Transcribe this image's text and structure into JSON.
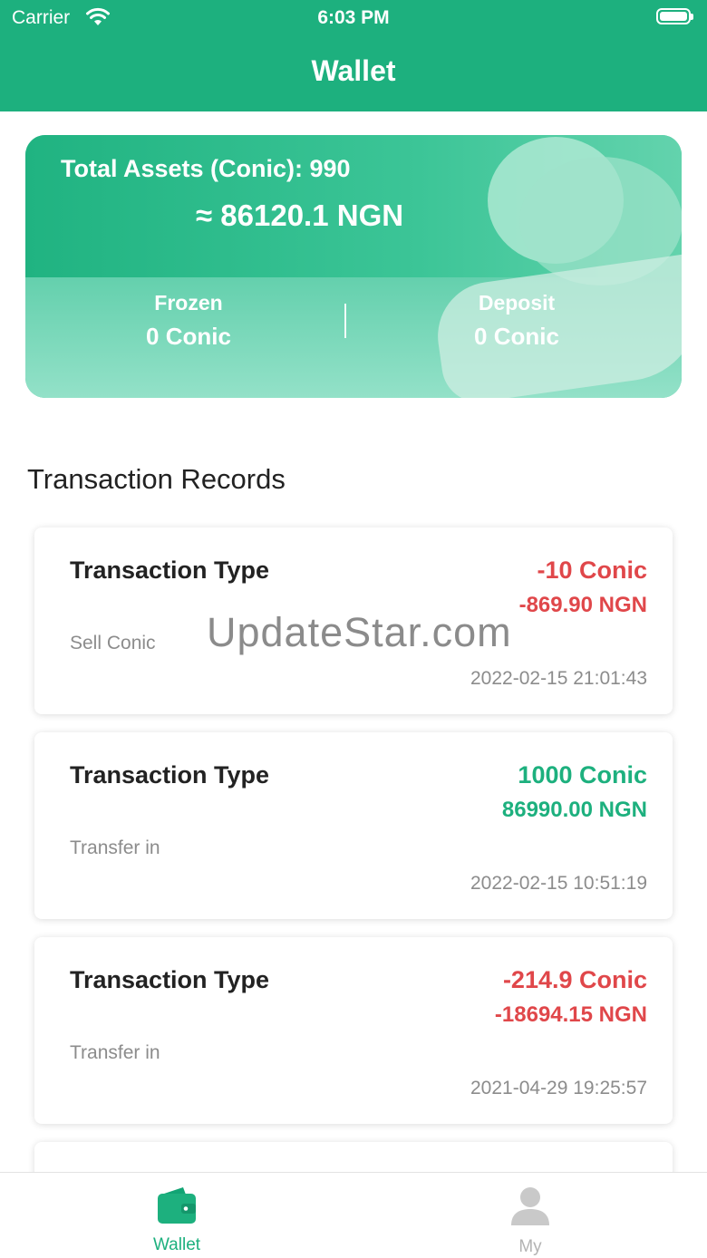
{
  "status_bar": {
    "carrier": "Carrier",
    "time": "6:03 PM"
  },
  "header": {
    "title": "Wallet"
  },
  "assets": {
    "total_label": "Total Assets (Conic): 990",
    "total_ngn": "≈ 86120.1 NGN",
    "frozen_label": "Frozen",
    "frozen_value": "0 Conic",
    "deposit_label": "Deposit",
    "deposit_value": "0 Conic"
  },
  "section_title": "Transaction Records",
  "transactions": [
    {
      "type_label": "Transaction Type",
      "amount": "-10 Conic",
      "ngn": "-869.90 NGN",
      "desc": "Sell Conic",
      "time": "2022-02-15 21:01:43"
    },
    {
      "type_label": "Transaction Type",
      "amount": "1000 Conic",
      "ngn": "86990.00 NGN",
      "desc": "Transfer in",
      "time": "2022-02-15 10:51:19"
    },
    {
      "type_label": "Transaction Type",
      "amount": "-214.9 Conic",
      "ngn": "-18694.15 NGN",
      "desc": "Transfer in",
      "time": "2021-04-29 19:25:57"
    }
  ],
  "watermark": "UpdateStar.com",
  "tabs": {
    "wallet": "Wallet",
    "my": "My"
  },
  "colors": {
    "brand": "#1db07e",
    "negative": "#e0474a",
    "positive": "#1db07e"
  }
}
